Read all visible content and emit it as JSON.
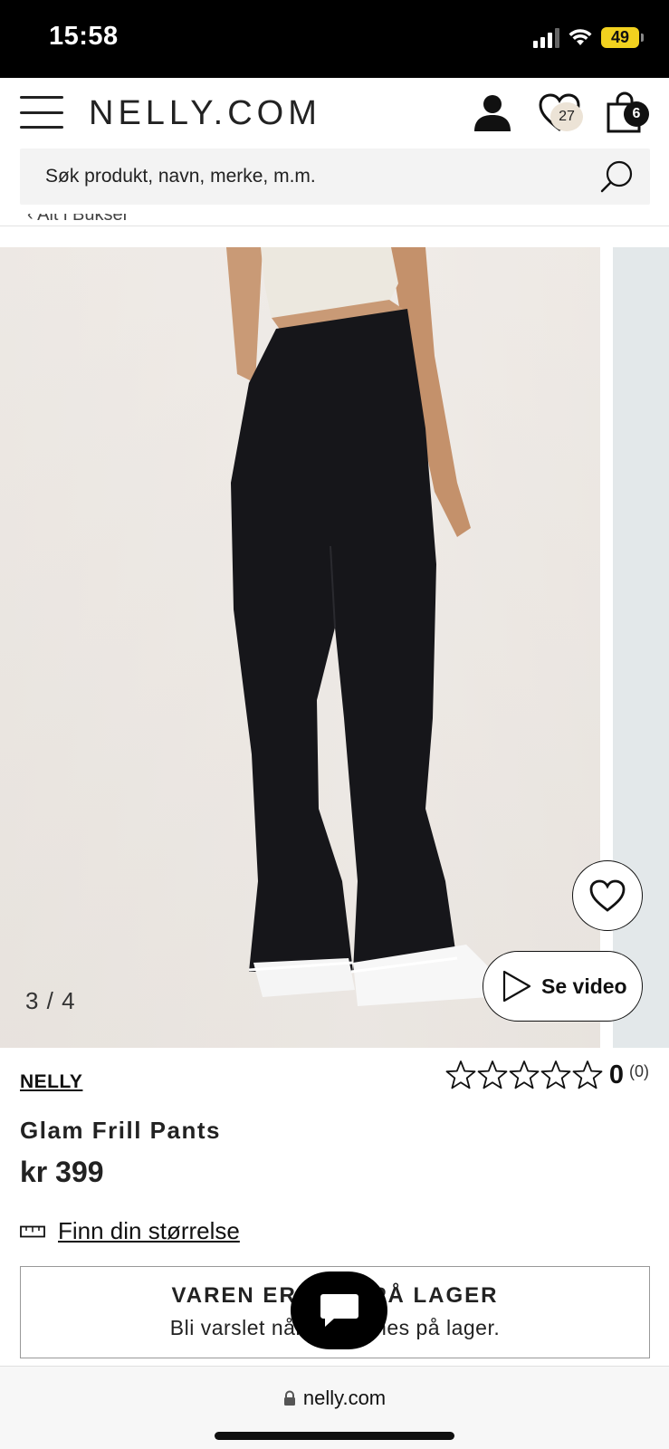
{
  "status_bar": {
    "time": "15:58",
    "battery": "49",
    "icons": [
      "signal-icon",
      "wifi-icon",
      "battery-icon"
    ]
  },
  "header": {
    "logo": "NELLY.COM",
    "wishlist_count": "27",
    "cart_count": "6",
    "icons": [
      "hamburger-menu-icon",
      "user-icon",
      "heart-icon",
      "shopping-bag-icon"
    ]
  },
  "search": {
    "placeholder": "Søk produkt, navn, merke, m.m."
  },
  "breadcrumb": {
    "label": "Alt i Bukser"
  },
  "gallery": {
    "counter": "3 / 4",
    "video_label": "Se video"
  },
  "product": {
    "brand": "NELLY",
    "name": "Glam Frill Pants",
    "price": "kr 399",
    "rating_score": "0",
    "rating_count": "(0)",
    "rating_stars_filled": 0,
    "rating_stars_total": 5
  },
  "size_guide": {
    "label": "Finn din størrelse"
  },
  "stock": {
    "title": "VAREN ER IKKE PÅ LAGER",
    "subtitle": "Bli varslet når den finnes på lager."
  },
  "browser": {
    "url": "nelly.com"
  },
  "colors": {
    "accent": "#111111",
    "badge_wishlist": "#ece3d6",
    "battery": "#f2d21f",
    "search_bg": "#f3f3f3"
  }
}
